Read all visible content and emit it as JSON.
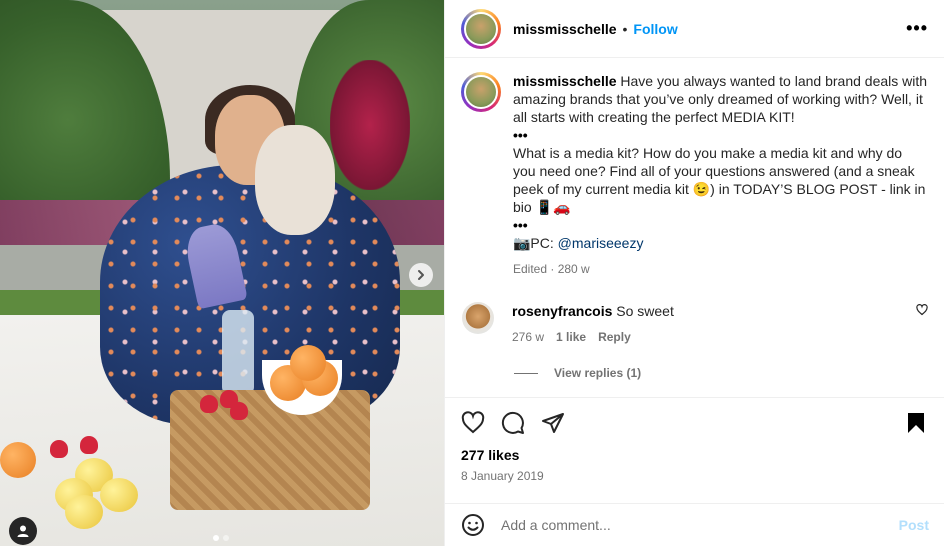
{
  "post": {
    "username": "missmisschelle",
    "separator": "•",
    "follow_label": "Follow",
    "more_label": "•••"
  },
  "caption": {
    "username": "missmisschelle",
    "line1": "Have you always wanted to land brand deals with amazing brands that you’ve only dreamed of working with? Well, it all starts with creating the perfect MEDIA KIT!",
    "dots1": "•••",
    "line2": "What is a media kit? How do you make a media kit and why do you need one? Find all of your questions answered (and a sneak peek of my current media kit 😉) in TODAY’S BLOG POST - link in bio 📱🚗",
    "dots2": "•••",
    "pc_prefix": "📷PC: ",
    "pc_mention": "@mariseeezy",
    "meta": "Edited · 280 w"
  },
  "comment": {
    "username": "rosenyfrancois",
    "text": "So sweet",
    "time": "276 w",
    "likes": "1 like",
    "reply": "Reply",
    "view_replies": "View replies (1)"
  },
  "stats": {
    "likes": "277 likes",
    "date": "8 January 2019"
  },
  "composer": {
    "placeholder": "Add a comment...",
    "post_label": "Post"
  },
  "carousel": {
    "total": 2,
    "current": 1
  },
  "colors": {
    "accent": "#0095f6",
    "post_disabled": "#b2dffc",
    "muted": "#737373"
  }
}
